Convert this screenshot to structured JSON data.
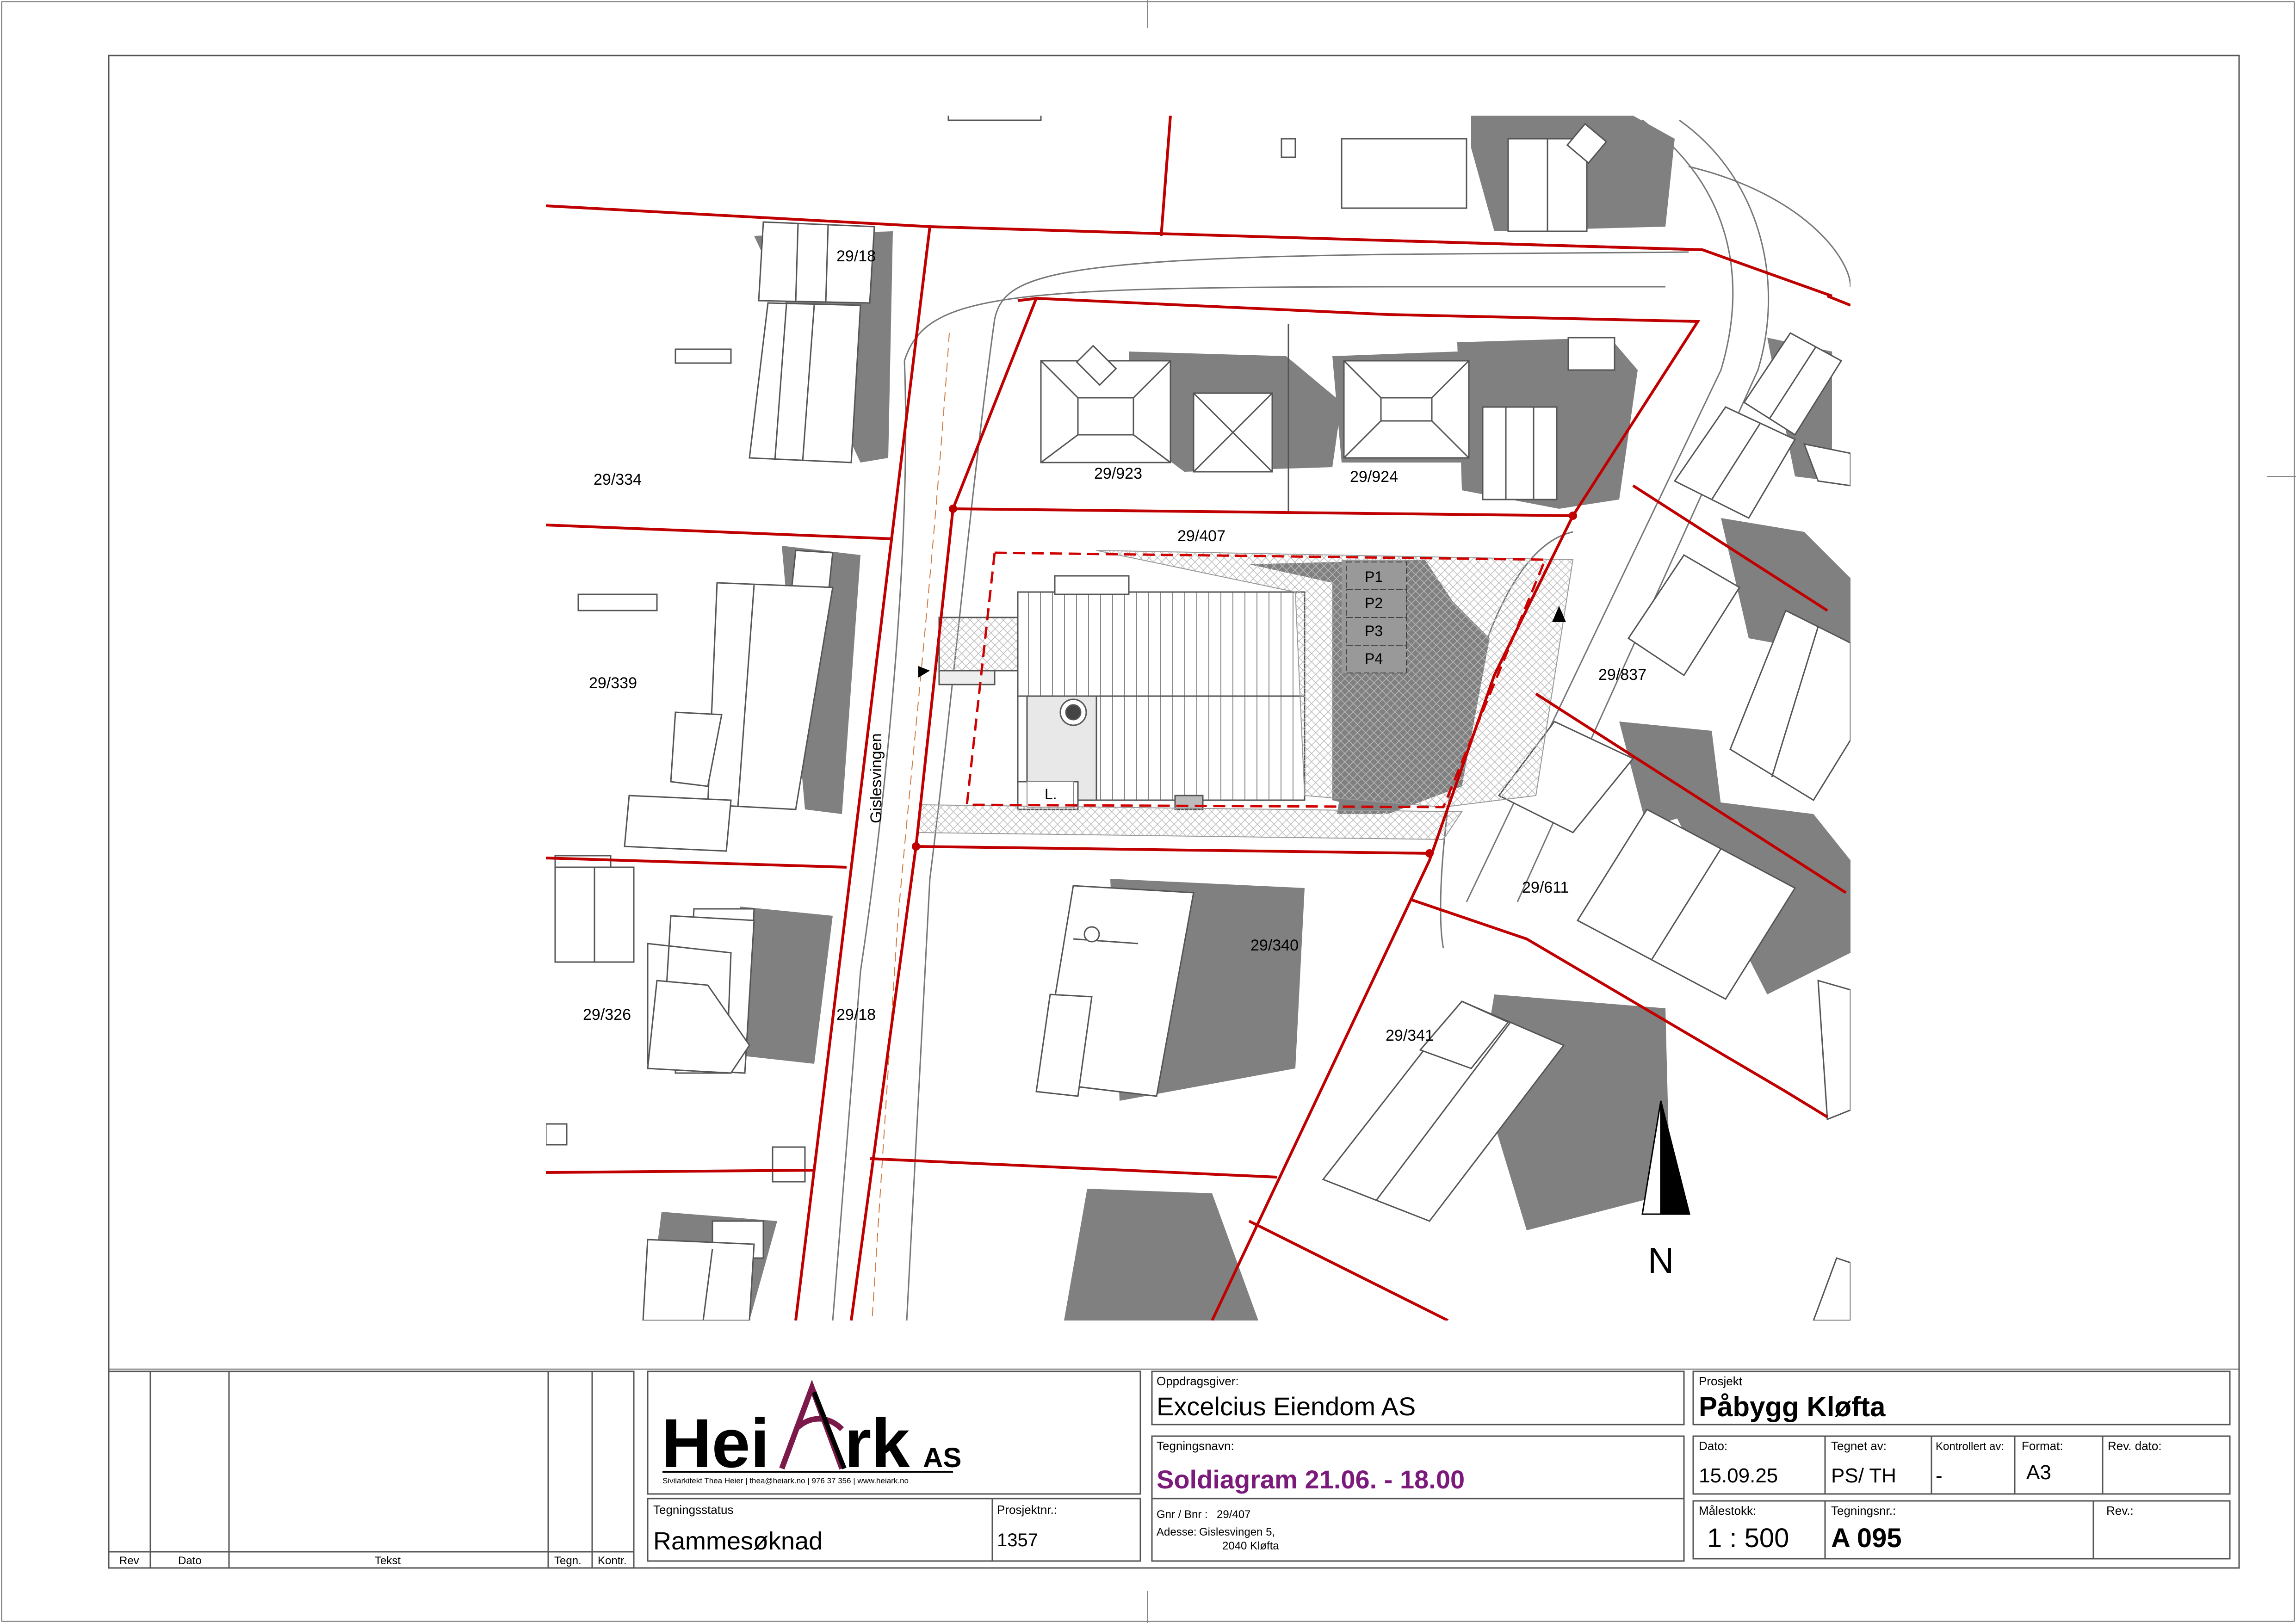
{
  "site_plan": {
    "road_name": "Gislesvingen",
    "north_label": "N",
    "plot_labels": {
      "p_29_18_top": "29/18",
      "p_29_334": "29/334",
      "p_29_339": "29/339",
      "p_29_326": "29/326",
      "p_29_18_road": "29/18",
      "p_29_923": "29/923",
      "p_29_924": "29/924",
      "p_29_407": "29/407",
      "p_29_837": "29/837",
      "p_29_611": "29/611",
      "p_29_340": "29/340",
      "p_29_341": "29/341"
    },
    "parking": [
      "P1",
      "P2",
      "P3",
      "P4"
    ],
    "bin_label": "L."
  },
  "title_block": {
    "revision_headers": {
      "rev": "Rev",
      "date": "Dato",
      "text": "Tekst",
      "drawn": "Tegn.",
      "checked": "Kontr."
    },
    "logo": {
      "wordmark_left": "Hei",
      "wordmark_right": "rk",
      "suffix": "AS",
      "tagline": "Sivilarkitekt Thea Heier  |  thea@heiark.no  |  976 37 356  |  www.heiark.no"
    },
    "status_label": "Tegningsstatus",
    "status_value": "Rammesøknad",
    "project_no_label": "Prosjektnr.:",
    "project_no_value": "1357",
    "client_label": "Oppdragsgiver:",
    "client_value": "Excelcius Eiendom AS",
    "drawing_name_label": "Tegningsnavn:",
    "drawing_name_value": "Soldiagram 21.06. - 18.00",
    "gnr_label": "Gnr / Bnr :",
    "gnr_value": "29/407",
    "address_label": "Adesse:",
    "address_line1": "Gislesvingen 5,",
    "address_line2": "2040 Kløfta",
    "project_label": "Prosjekt",
    "project_value": "Påbygg Kløfta",
    "date_label": "Dato:",
    "date_value": "15.09.25",
    "drawn_by_label": "Tegnet av:",
    "drawn_by_value": "PS/ TH",
    "checked_by_label": "Kontrollert av:",
    "checked_by_value": "-",
    "format_label": "Format:",
    "format_value": "A3",
    "rev_date_label": "Rev. dato:",
    "scale_label": "Målestokk:",
    "scale_value": "1 : 500",
    "drawing_no_label": "Tegningsnr.:",
    "drawing_no_value": "A 095",
    "rev_label": "Rev.:"
  },
  "colors": {
    "boundary": "#c00000",
    "shadow": "#808080",
    "drawing_title": "#7b1a7b",
    "logo_accent": "#7b1a4a"
  }
}
